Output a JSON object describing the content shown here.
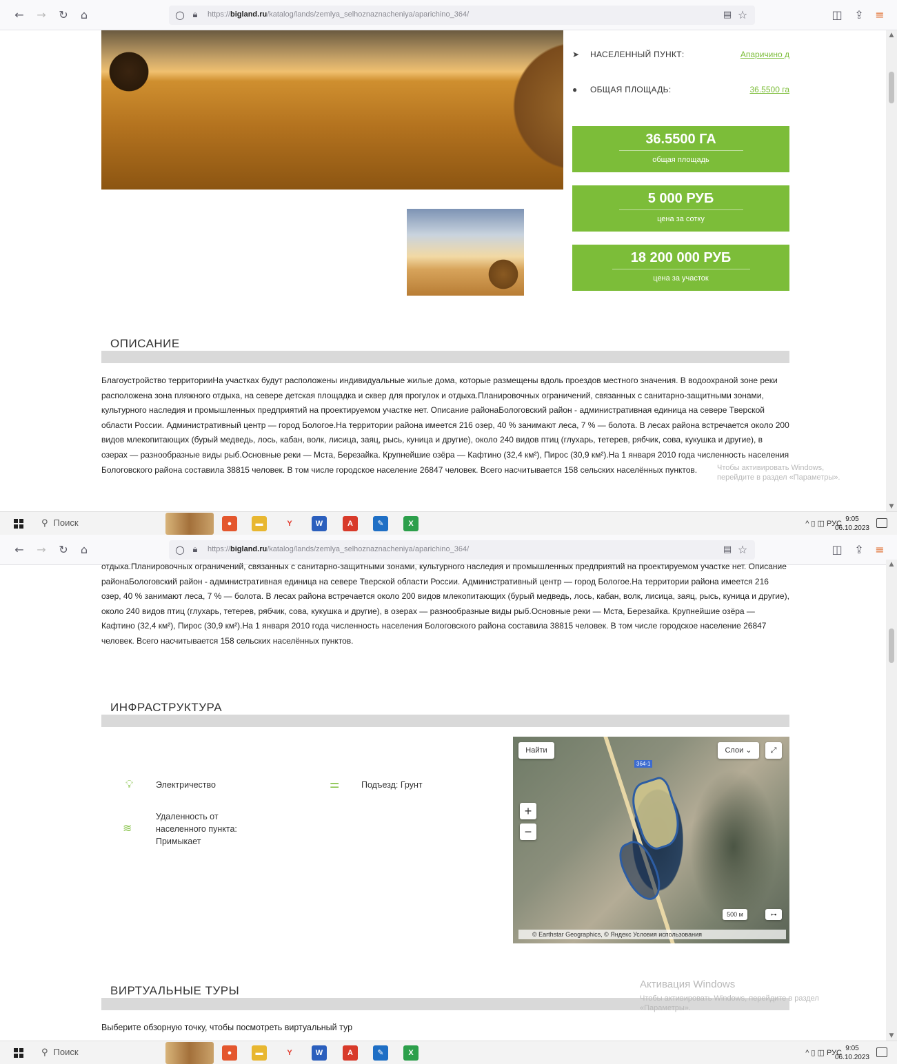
{
  "browser": {
    "url_prefix": "https://",
    "url_domain": "bigland.ru",
    "url_path": "/katalog/lands/zemlya_selhoznaznacheniya/aparichino_364/",
    "back_icon": "arrow-left-icon",
    "forward_icon": "arrow-right-icon",
    "reload_icon": "reload-icon",
    "home_icon": "home-icon"
  },
  "taskbar": {
    "search_label": "Поиск",
    "tray_lang": "РУС",
    "clock_time": "9:05",
    "clock_date": "06.10.2023"
  },
  "listing": {
    "locality_label": "НАСЕЛЕННЫЙ ПУНКТ:",
    "locality_value": "Апаричино д",
    "area_label": "ОБЩАЯ ПЛОЩАДЬ:",
    "area_value": "36.5500 га",
    "boxes": [
      {
        "value": "36.5500 ГА",
        "caption": "общая площадь"
      },
      {
        "value": "5 000 РУБ",
        "caption": "цена за сотку"
      },
      {
        "value": "18 200 000 РУБ",
        "caption": "цена за участок"
      }
    ]
  },
  "description": {
    "title": "ОПИСАНИЕ",
    "text": "Благоустройство территорииНа участках будут расположены индивидуальные жилые дома, которые размещены вдоль проездов местного значения.  В водоохраной зоне реки расположена зона пляжного отдыха, на севере детская площадка и сквер для прогулок и отдыха.Планировочных ограничений, связанных с санитарно-защитными зонами, культурного наследия и промышленных предприятий на проектируемом участке нет. Описание районаБологовский район - административная единица на севере Тверской области России. Административный центр — город Бологое.На территории района имеется 216 озер, 40 % занимают леса, 7 % — болота. В лесах района встречается около 200 видов млекопитающих (бурый медведь, лось, кабан, волк, лисица, заяц, рысь, куница и другие), около 240 видов птиц (глухарь, тетерев, рябчик, сова, кукушка и другие), в озерах — разнообразные виды рыб.Основные реки — Мста, Березайка. Крупнейшие озёра — Кафтино (32,4 км²), Пирос (30,9 км²).На 1 января 2010 года численность населения Бологовского района составила 38815 человек. В том числе городское население 26847 человек. Всего насчитывается 158 сельских населённых пунктов.",
    "text_tail": "отдыха.Планировочных ограничений, связанных с санитарно-защитными зонами, культурного наследия и промышленных предприятий на проектируемом участке нет. Описание районаБологовский район - административная единица на севере Тверской области России. Административный центр — город Бологое.На территории района имеется 216 озер, 40 % занимают леса, 7 % — болота. В лесах района встречается около 200 видов млекопитающих (бурый медведь, лось, кабан, волк, лисица, заяц, рысь, куница и другие), около 240 видов птиц (глухарь, тетерев, рябчик, сова, кукушка и другие), в озерах — разнообразные виды рыб.Основные реки — Мста, Березайка. Крупнейшие озёра — Кафтино (32,4 км²), Пирос (30,9 км²).На 1 января 2010 года численность населения Бологовского района составила 38815 человек. В том числе городское население 26847 человек. Всего насчитывается 158 сельских населённых пунктов."
  },
  "infrastructure": {
    "title": "ИНФРАСТРУКТУРА",
    "items": [
      {
        "label": "Электричество",
        "icon": "lightbulb-icon"
      },
      {
        "label": "Подъезд: Грунт",
        "icon": "road-icon"
      },
      {
        "label": "Удаленность от населенного пункта: Примыкает",
        "icon": "distance-icon"
      }
    ],
    "map": {
      "find_label": "Найти",
      "layers_label": "Слои",
      "zoom_in": "+",
      "zoom_out": "−",
      "scale_label": "500 м",
      "copyright": "© Earthstar Geographics, © Яндекс Условия использования",
      "plot_tag": "364-1"
    }
  },
  "tours": {
    "title": "ВИРТУАЛЬНЫЕ ТУРЫ",
    "text": "Выберите обзорную точку, чтобы посмотреть виртуальный тур"
  },
  "watermark": {
    "title": "Активация Windows",
    "line": "Чтобы активировать Windows, перейдите в раздел «Параметры»."
  }
}
